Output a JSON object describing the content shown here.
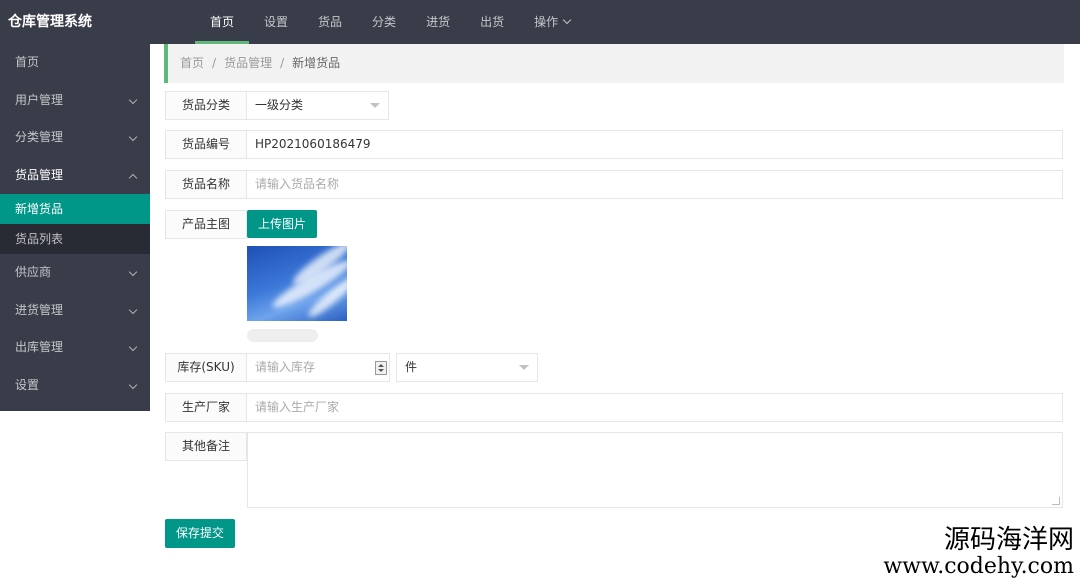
{
  "app": {
    "title": "仓库管理系统"
  },
  "topnav": [
    {
      "label": "首页",
      "active": true
    },
    {
      "label": "设置"
    },
    {
      "label": "货品"
    },
    {
      "label": "分类"
    },
    {
      "label": "进货"
    },
    {
      "label": "出货"
    },
    {
      "label": "操作",
      "has_dropdown": true
    }
  ],
  "sidebar": {
    "items": [
      {
        "label": "首页"
      },
      {
        "label": "用户管理",
        "expandable": true
      },
      {
        "label": "分类管理",
        "expandable": true
      },
      {
        "label": "货品管理",
        "expandable": true,
        "expanded": true,
        "children": [
          {
            "label": "新增货品",
            "active": true
          },
          {
            "label": "货品列表"
          }
        ]
      },
      {
        "label": "供应商",
        "expandable": true
      },
      {
        "label": "进货管理",
        "expandable": true
      },
      {
        "label": "出库管理",
        "expandable": true
      },
      {
        "label": "设置",
        "expandable": true
      }
    ]
  },
  "breadcrumb": {
    "items": [
      "首页",
      "货品管理",
      "新增货品"
    ],
    "separator": "/"
  },
  "form": {
    "category": {
      "label": "货品分类",
      "value": "一级分类"
    },
    "code": {
      "label": "货品编号",
      "value": "HP2021060186479"
    },
    "name": {
      "label": "货品名称",
      "placeholder": "请输入货品名称"
    },
    "image": {
      "label": "产品主图",
      "upload_label": "上传图片"
    },
    "stock": {
      "label": "库存(SKU)",
      "placeholder": "请输入库存",
      "unit_value": "件"
    },
    "manufacturer": {
      "label": "生产厂家",
      "placeholder": "请输入生产厂家"
    },
    "remark": {
      "label": "其他备注"
    },
    "submit_label": "保存提交"
  },
  "watermark": {
    "line1": "源码海洋网",
    "line2": "www.codehy.com"
  },
  "colors": {
    "topbar_bg": "#393d49",
    "accent": "#009688",
    "active_underline": "#5fb878",
    "sub_menu_bg": "#282b33"
  }
}
